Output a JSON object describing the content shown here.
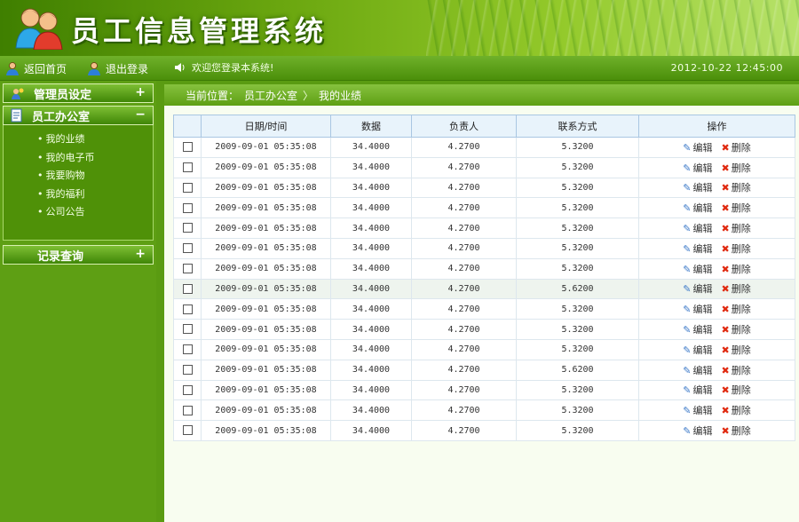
{
  "header": {
    "title": "员工信息管理系统"
  },
  "toolbar": {
    "home_label": "返回首页",
    "logout_label": "退出登录",
    "welcome": "欢迎您登录本系统!",
    "datetime": "2012-10-22 12:45:00"
  },
  "sidebar": {
    "groups": [
      {
        "label": "管理员设定",
        "toggle": "+"
      },
      {
        "label": "员工办公室",
        "toggle": "−",
        "items": [
          "我的业绩",
          "我的电子币",
          "我要购物",
          "我的福利",
          "公司公告"
        ]
      },
      {
        "label": "记录查询",
        "toggle": "+"
      }
    ]
  },
  "breadcrumb": {
    "prefix": "当前位置：",
    "section": "员工办公室",
    "separator": "〉",
    "page": "我的业绩"
  },
  "table": {
    "columns": [
      "",
      "日期/时间",
      "数据",
      "负责人",
      "联系方式",
      "操作"
    ],
    "edit_label": "编辑",
    "delete_label": "删除",
    "rows": [
      [
        "2009-09-01 05:35:08",
        "34.4000",
        "4.2700",
        "5.3200"
      ],
      [
        "2009-09-01 05:35:08",
        "34.4000",
        "4.2700",
        "5.3200"
      ],
      [
        "2009-09-01 05:35:08",
        "34.4000",
        "4.2700",
        "5.3200"
      ],
      [
        "2009-09-01 05:35:08",
        "34.4000",
        "4.2700",
        "5.3200"
      ],
      [
        "2009-09-01 05:35:08",
        "34.4000",
        "4.2700",
        "5.3200"
      ],
      [
        "2009-09-01 05:35:08",
        "34.4000",
        "4.2700",
        "5.3200"
      ],
      [
        "2009-09-01 05:35:08",
        "34.4000",
        "4.2700",
        "5.3200"
      ],
      [
        "2009-09-01 05:35:08",
        "34.4000",
        "4.2700",
        "5.6200"
      ],
      [
        "2009-09-01 05:35:08",
        "34.4000",
        "4.2700",
        "5.3200"
      ],
      [
        "2009-09-01 05:35:08",
        "34.4000",
        "4.2700",
        "5.3200"
      ],
      [
        "2009-09-01 05:35:08",
        "34.4000",
        "4.2700",
        "5.3200"
      ],
      [
        "2009-09-01 05:35:08",
        "34.4000",
        "4.2700",
        "5.6200"
      ],
      [
        "2009-09-01 05:35:08",
        "34.4000",
        "4.2700",
        "5.3200"
      ],
      [
        "2009-09-01 05:35:08",
        "34.4000",
        "4.2700",
        "5.3200"
      ],
      [
        "2009-09-01 05:35:08",
        "34.4000",
        "4.2700",
        "5.3200"
      ]
    ]
  }
}
